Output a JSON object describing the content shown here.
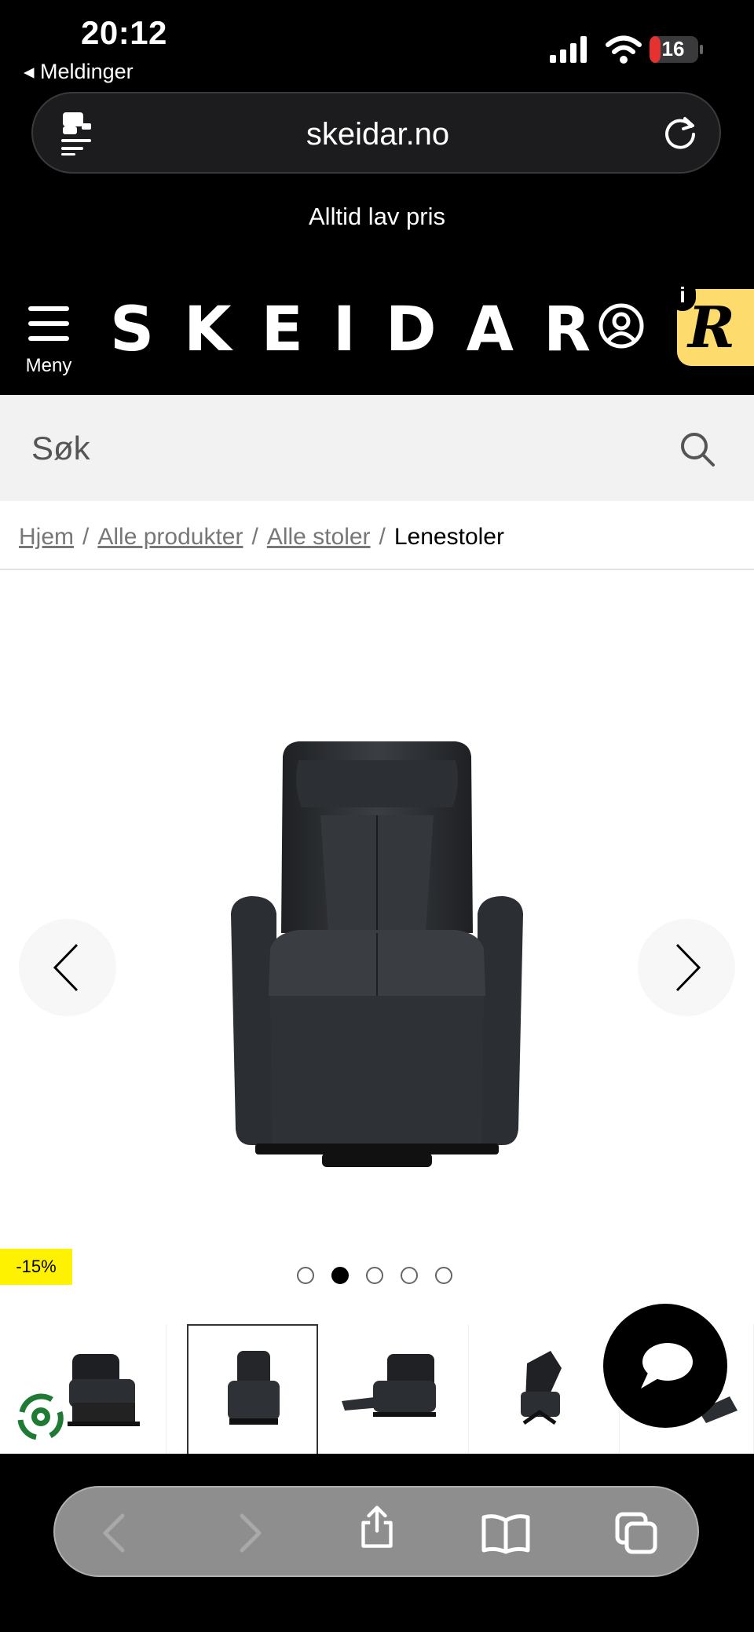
{
  "status_bar": {
    "time": "20:12",
    "back_label": "◂ Meldinger",
    "battery": "16"
  },
  "browser": {
    "url": "skeidar.no"
  },
  "promo": {
    "text": "Alltid lav pris"
  },
  "header": {
    "menu_label": "Meny",
    "logo": "SKEIDAR",
    "rewards_letter": "R",
    "rewards_info": "i"
  },
  "search": {
    "placeholder": "Søk"
  },
  "breadcrumb": {
    "items": [
      "Hjem",
      "Alle produkter",
      "Alle stoler"
    ],
    "current": "Lenestoler",
    "separator": "/"
  },
  "product": {
    "discount": "-15%",
    "image": "black leather recliner chair",
    "gallery_count": 5,
    "active_image": 2
  },
  "colors": {
    "background": "#000000",
    "badge": "#fff200",
    "rewards": "#fddb6c"
  },
  "icons": [
    "reader-icon",
    "reload-icon",
    "menu-icon",
    "account-icon",
    "search-icon",
    "chevron-left-icon",
    "chevron-right-icon",
    "recycle-icon",
    "chat-icon",
    "back-icon",
    "forward-icon",
    "share-icon",
    "bookmarks-icon",
    "tabs-icon"
  ]
}
